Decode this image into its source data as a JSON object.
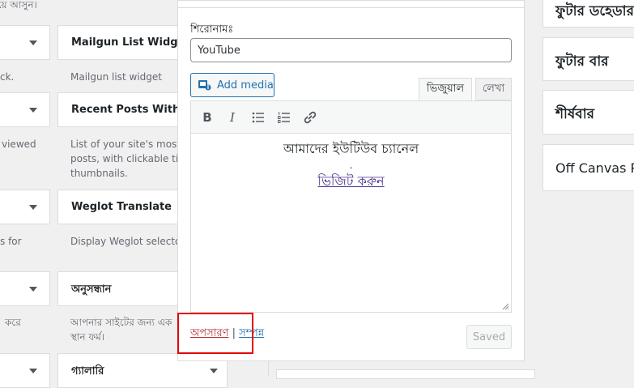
{
  "left_widgets": {
    "top_fragment": "ছিয়ে আসুন।",
    "col0_frag1": "ck.",
    "col0_frag2": "viewed",
    "col0_frag3": "s for",
    "col0_frag4": "করে",
    "mailgun": {
      "title": "Mailgun List Widget",
      "desc": "Mailgun list widget"
    },
    "recent": {
      "title": "Recent Posts With Th...",
      "desc_line1": "List of your site's most re",
      "desc_line2": "posts, with clickable title",
      "desc_line3": "thumbnails."
    },
    "weglot": {
      "title": "Weglot Translate",
      "desc": "Display Weglot selector i"
    },
    "search": {
      "title": "অনুসন্ধান",
      "desc_line1": "আপনার সাইটের জন্য এক",
      "desc_line2": "স্থান ফর্ম।"
    },
    "gallery": {
      "title": "গ্যালারি"
    }
  },
  "editor_panel": {
    "title_label": "শিরোনামঃ",
    "title_value": "YouTube",
    "add_media": "Add media",
    "tab_visual": "ভিজুয়াল",
    "tab_text": "লেখা",
    "toolbar": {
      "bold": "B",
      "italic": "I"
    },
    "content_line1": "আমাদের ইউটিউব চ্যানেল",
    "content_dot": ".",
    "content_link": "ভিজিট করুন",
    "delete_link": "অপসারণ",
    "separator": "|",
    "done_link": "সম্পন্ন",
    "saved_button": "Saved"
  },
  "right_sidebar": {
    "footer_header": "ফুটার ডহেডার",
    "footer_bar": "ফুটার বার",
    "header_bar": "শীর্ষবার",
    "off_canvas": "Off Canvas P"
  },
  "colors": {
    "accent": "#2271b1",
    "delete": "#b32d2e",
    "highlight": "#e00000"
  }
}
